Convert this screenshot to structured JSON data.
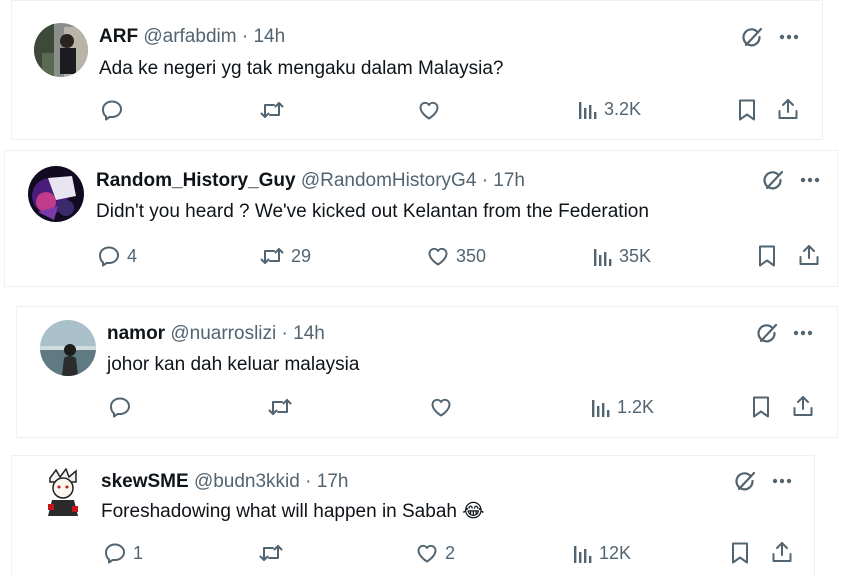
{
  "tweets": [
    {
      "name": "ARF",
      "handle": "@arfabdim",
      "time": "14h",
      "text": "Ada ke negeri yg tak mengaku dalam Malaysia?",
      "replies": "",
      "retweets": "",
      "likes": "",
      "views": "3.2K"
    },
    {
      "name": "Random_History_Guy",
      "handle": "@RandomHistoryG4",
      "time": "17h",
      "text": "Didn't you heard ? We've kicked out Kelantan from the Federation",
      "replies": "4",
      "retweets": "29",
      "likes": "350",
      "views": "35K"
    },
    {
      "name": "namor",
      "handle": "@nuarroslizi",
      "time": "14h",
      "text": "johor kan dah keluar malaysia",
      "replies": "",
      "retweets": "",
      "likes": "",
      "views": "1.2K"
    },
    {
      "name": "skewSME",
      "handle": "@budn3kkid",
      "time": "17h",
      "text": "Foreshadowing what will happen in Sabah 😂",
      "replies": "1",
      "retweets": "",
      "likes": "2",
      "views": "12K"
    }
  ],
  "separator": "·",
  "colors": {
    "text": "#0f1419",
    "muted": "#536471",
    "border": "#eef1f3"
  },
  "icons": [
    "reply-icon",
    "retweet-icon",
    "like-icon",
    "views-icon",
    "bookmark-icon",
    "share-icon",
    "grok-icon",
    "more-icon"
  ]
}
